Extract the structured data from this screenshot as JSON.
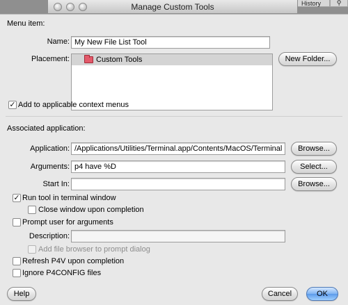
{
  "background": {
    "tabs": {
      "history": "History"
    }
  },
  "window": {
    "title": "Manage Custom Tools"
  },
  "menu_item": {
    "section_label": "Menu item:",
    "name_label": "Name:",
    "name_value": "My New File List  Tool",
    "placement_label": "Placement:",
    "placement_items": [
      "Custom Tools"
    ],
    "new_folder_button": "New Folder...",
    "context_menus_label": "Add to applicable context menus",
    "context_menus_checked": true
  },
  "associated_application": {
    "section_label": "Associated application:",
    "application_label": "Application:",
    "application_value": "/Applications/Utilities/Terminal.app/Contents/MacOS/Terminal",
    "application_browse": "Browse...",
    "arguments_label": "Arguments:",
    "arguments_value": "p4 have %D",
    "arguments_select": "Select...",
    "start_in_label": "Start In:",
    "start_in_value": "",
    "start_in_browse": "Browse..."
  },
  "options": {
    "run_in_terminal": {
      "label": "Run tool in terminal window",
      "checked": true
    },
    "close_on_completion": {
      "label": "Close window upon completion",
      "checked": false
    },
    "prompt_for_arguments": {
      "label": "Prompt user for arguments",
      "checked": false
    },
    "description_label": "Description:",
    "description_value": "",
    "add_file_browser": {
      "label": "Add file browser to prompt dialog",
      "checked": false
    },
    "refresh_p4v": {
      "label": "Refresh P4V upon completion",
      "checked": false
    },
    "ignore_p4config": {
      "label": "Ignore P4CONFIG files",
      "checked": false
    }
  },
  "footer": {
    "help_button": "Help",
    "cancel_button": "Cancel",
    "ok_button": "OK"
  },
  "colors": {
    "accent_button": "#7fb3f2",
    "folder_icon": "#e35a6a",
    "panel_background": "#e8e8e8"
  }
}
